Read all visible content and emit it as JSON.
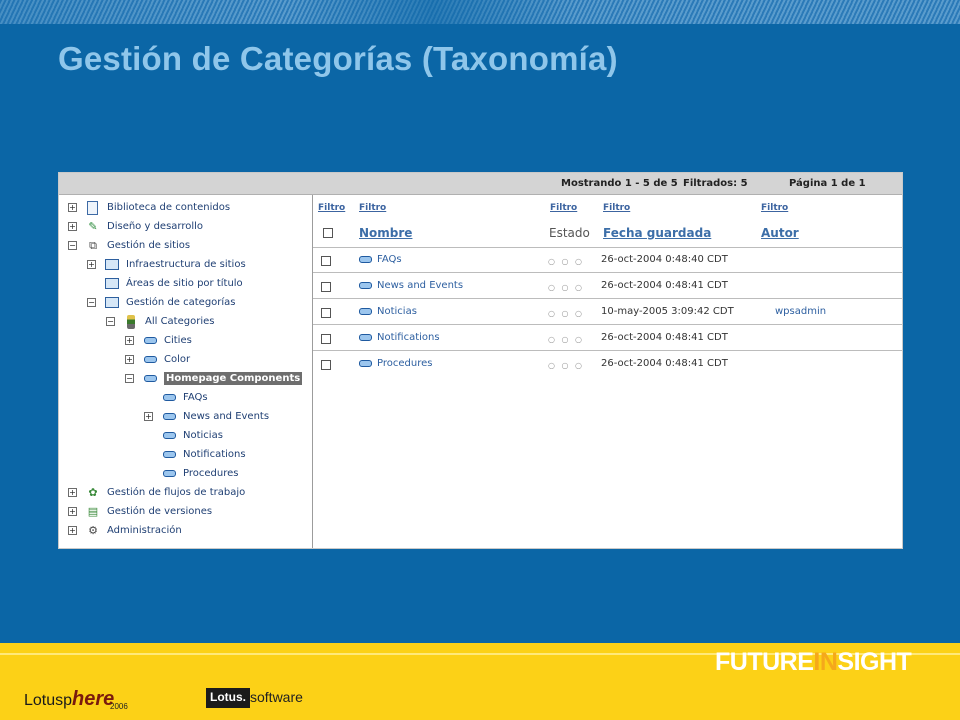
{
  "title": "Gestión de Categorías (Taxonomía)",
  "status_bar": {
    "showing": "Mostrando 1 - 5 de 5",
    "filtered": "Filtrados: 5",
    "page": "Página 1 de 1"
  },
  "tree": [
    {
      "label": "Biblioteca de contenidos",
      "toggle": "+"
    },
    {
      "label": "Diseño y desarrollo",
      "toggle": "+"
    },
    {
      "label": "Gestión de sitios",
      "toggle": "−"
    },
    {
      "label": "Infraestructura de sitios",
      "toggle": "+"
    },
    {
      "label": "Áreas de sitio por título",
      "toggle": ""
    },
    {
      "label": "Gestión de categorías",
      "toggle": "−"
    },
    {
      "label": "All Categories",
      "toggle": "−"
    },
    {
      "label": "Cities",
      "toggle": "+"
    },
    {
      "label": "Color",
      "toggle": "+"
    },
    {
      "label": "Homepage Components",
      "toggle": "−"
    },
    {
      "label": "FAQs",
      "toggle": ""
    },
    {
      "label": "News and Events",
      "toggle": "+"
    },
    {
      "label": "Noticias",
      "toggle": ""
    },
    {
      "label": "Notifications",
      "toggle": ""
    },
    {
      "label": "Procedures",
      "toggle": ""
    },
    {
      "label": "Gestión de flujos de trabajo",
      "toggle": "+"
    },
    {
      "label": "Gestión de versiones",
      "toggle": "+"
    },
    {
      "label": "Administración",
      "toggle": "+"
    }
  ],
  "table": {
    "filter_label": "Filtro",
    "columns": {
      "name": "Nombre",
      "status": "Estado",
      "date": "Fecha guardada",
      "author": "Autor"
    },
    "rows": [
      {
        "name": "FAQs",
        "status": "○ ○ ○",
        "date": "26-oct-2004 0:48:40 CDT",
        "author": ""
      },
      {
        "name": "News and Events",
        "status": "○ ○ ○",
        "date": "26-oct-2004 0:48:41 CDT",
        "author": ""
      },
      {
        "name": "Noticias",
        "status": "○ ○ ○",
        "date": "10-may-2005 3:09:42 CDT",
        "author": "wpsadmin"
      },
      {
        "name": "Notifications",
        "status": "○ ○ ○",
        "date": "26-oct-2004 0:48:41 CDT",
        "author": ""
      },
      {
        "name": "Procedures",
        "status": "○ ○ ○",
        "date": "26-oct-2004 0:48:41 CDT",
        "author": ""
      }
    ]
  },
  "footer": {
    "future": "FUTURE",
    "insight_in": "IN",
    "insight_sight": "SIGHT",
    "lotusphere_prefix": "Lotusp",
    "lotusphere_here": "here",
    "year": "2006",
    "lotus": "Lotus.",
    "software": "software"
  }
}
